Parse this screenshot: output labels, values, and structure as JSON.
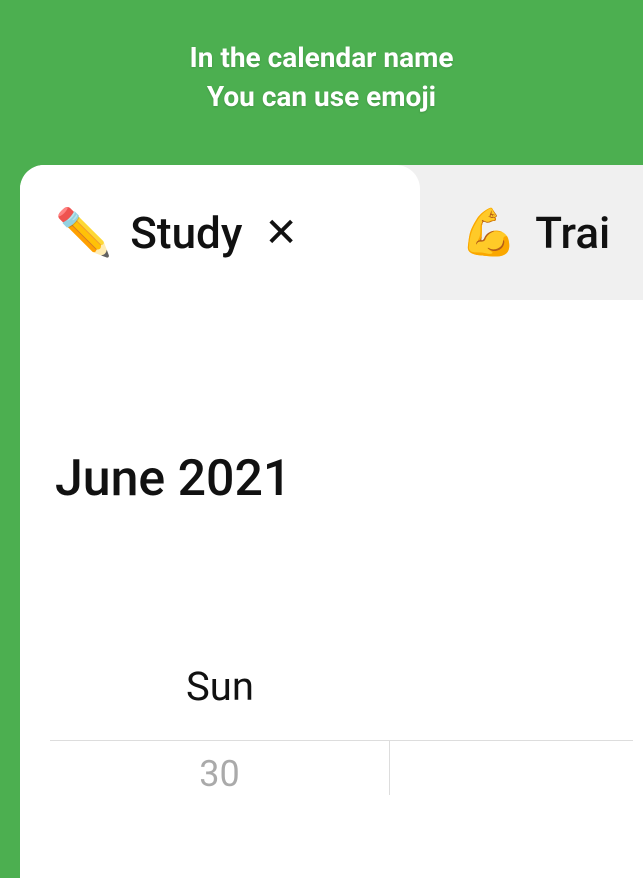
{
  "header": {
    "line1": "In the calendar name",
    "line2": "You can use emoji"
  },
  "tabs": [
    {
      "emoji": "✏️",
      "label": "Study",
      "active": true,
      "closeable": true
    },
    {
      "emoji": "💪",
      "label": "Trai",
      "active": false,
      "closeable": false
    }
  ],
  "closeSymbol": "✕",
  "calendar": {
    "monthTitle": "June 2021",
    "dayHeaders": [
      "Sun"
    ],
    "cells": [
      {
        "date": "30",
        "prevMonth": true
      }
    ]
  }
}
